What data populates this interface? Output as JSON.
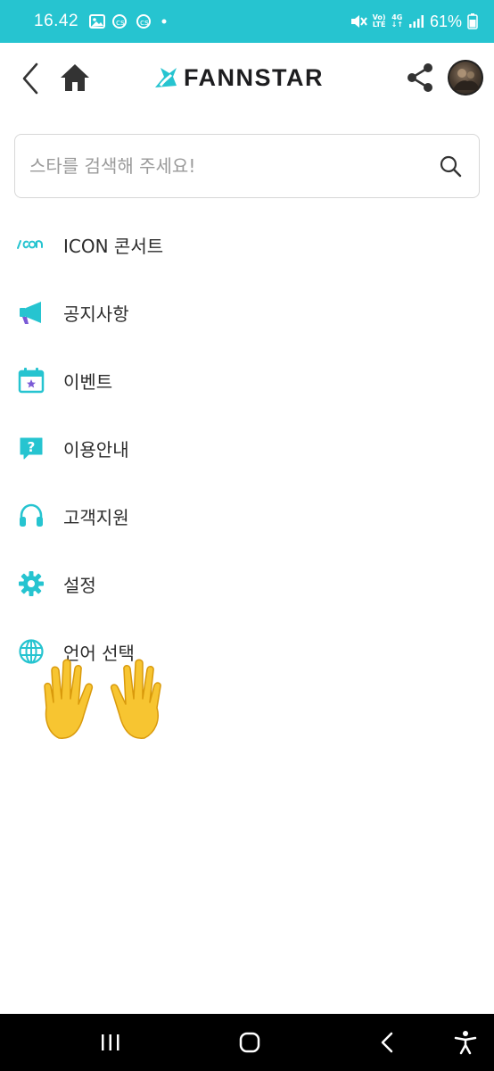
{
  "status_bar": {
    "time": "16.42",
    "network_top": "Vo)",
    "network_bottom": "LTE",
    "network_gen": "4G",
    "battery": "61%"
  },
  "header": {
    "brand": "FANNSTAR"
  },
  "search": {
    "placeholder": "스타를 검색해 주세요!"
  },
  "menu": [
    {
      "label": "ICON 콘서트",
      "icon": "icon-logo"
    },
    {
      "label": "공지사항",
      "icon": "megaphone-icon"
    },
    {
      "label": "이벤트",
      "icon": "calendar-star-icon"
    },
    {
      "label": "이용안내",
      "icon": "question-bubble-icon"
    },
    {
      "label": "고객지원",
      "icon": "headphones-icon"
    },
    {
      "label": "설정",
      "icon": "gear-icon"
    },
    {
      "label": "언어 선택",
      "icon": "globe-icon"
    }
  ],
  "colors": {
    "accent": "#26c4d0",
    "purple": "#7b5bd6"
  }
}
